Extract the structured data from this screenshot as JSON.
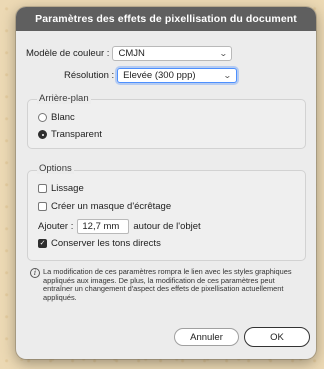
{
  "dialog": {
    "title": "Paramètres des effets de pixellisation du document"
  },
  "color_model": {
    "label": "Modèle de couleur :",
    "value": "CMJN"
  },
  "resolution": {
    "label": "Résolution :",
    "value": "Elevée (300 ppp)"
  },
  "background": {
    "title": "Arrière-plan",
    "options": [
      {
        "label": "Blanc",
        "selected": false
      },
      {
        "label": "Transparent",
        "selected": true
      }
    ]
  },
  "options": {
    "title": "Options",
    "antialias": {
      "label": "Lissage",
      "checked": false
    },
    "clipping_mask": {
      "label": "Créer un masque d'écrêtage",
      "checked": false
    },
    "add": {
      "label": "Ajouter :",
      "value": "12,7 mm",
      "suffix": "autour de l'objet"
    },
    "preserve_spot": {
      "label": "Conserver les tons directs",
      "checked": true
    }
  },
  "info_text": "La modification de ces paramètres rompra le lien avec les styles graphiques appliqués aux images. De plus, la modification de ces paramètres peut entraîner un changement d'aspect des effets de pixellisation actuellement appliqués.",
  "buttons": {
    "cancel": "Annuler",
    "ok": "OK"
  }
}
